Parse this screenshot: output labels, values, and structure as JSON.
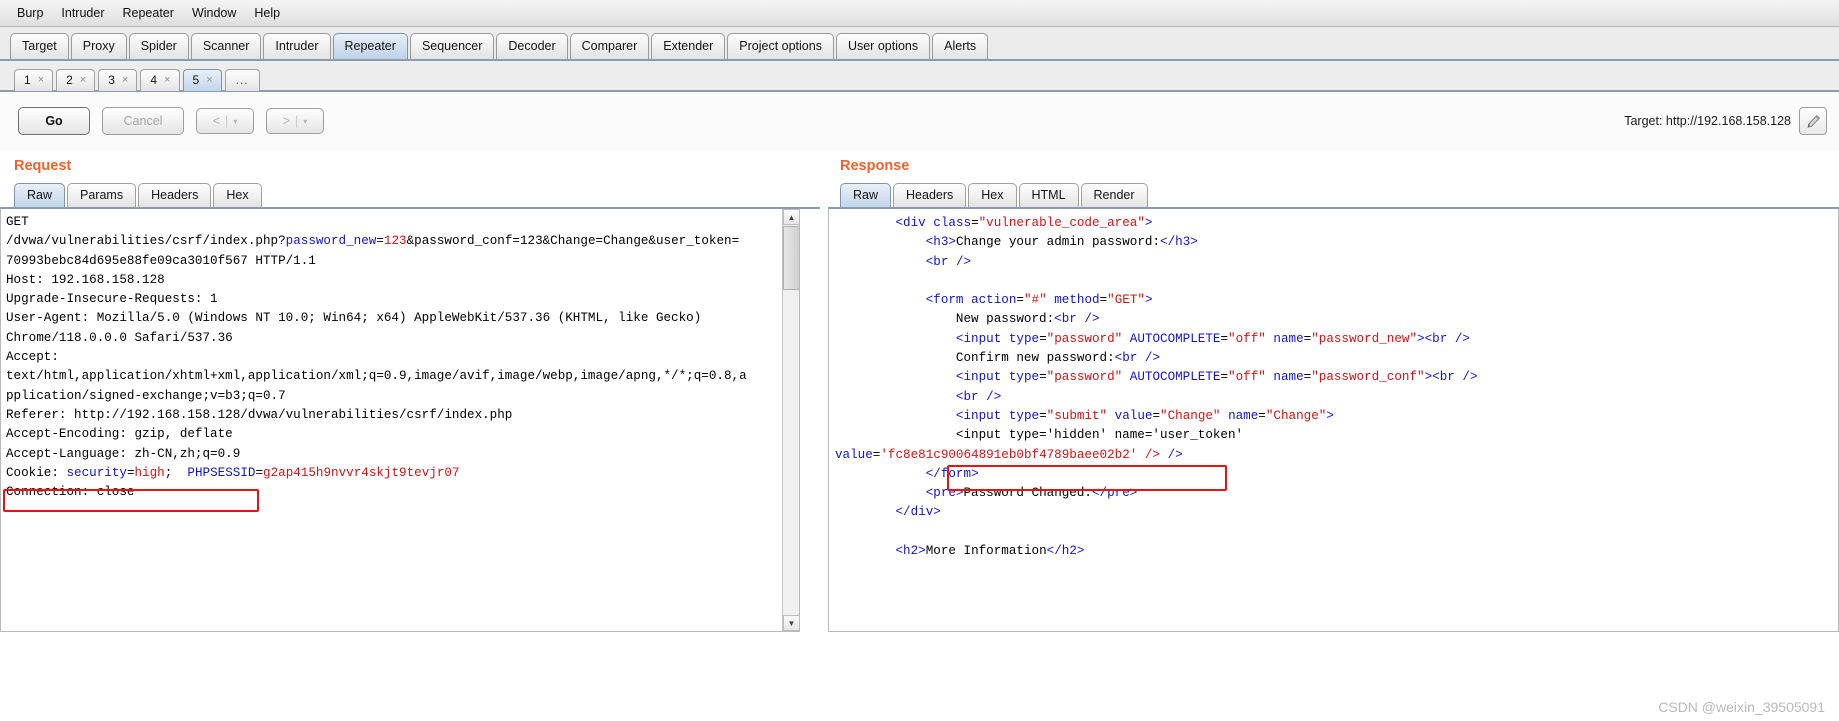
{
  "menubar": {
    "items": [
      "Burp",
      "Intruder",
      "Repeater",
      "Window",
      "Help"
    ]
  },
  "main_tabs": {
    "items": [
      "Target",
      "Proxy",
      "Spider",
      "Scanner",
      "Intruder",
      "Repeater",
      "Sequencer",
      "Decoder",
      "Comparer",
      "Extender",
      "Project options",
      "User options",
      "Alerts"
    ],
    "active": "Repeater"
  },
  "repeater_tabs": {
    "items": [
      "1",
      "2",
      "3",
      "4",
      "5"
    ],
    "close_glyph": "×",
    "overflow_label": "...",
    "active": "5"
  },
  "toolbar": {
    "go_label": "Go",
    "cancel_label": "Cancel",
    "back_label": "<",
    "forward_label": ">",
    "dropdown_glyph": "▾",
    "separator_glyph": "|",
    "target_label": "Target: http://192.168.158.128",
    "edit_icon": "pencil-icon"
  },
  "request": {
    "title": "Request",
    "tabs": [
      "Raw",
      "Params",
      "Headers",
      "Hex"
    ],
    "active_tab": "Raw",
    "highlighted_token": "70993bebc84d695e88fe09ca3010f567",
    "lines": [
      "GET",
      "/dvwa/vulnerabilities/csrf/index.php?password_new=123&password_conf=123&Change=Change&user_token=",
      "70993bebc84d695e88fe09ca3010f567 HTTP/1.1",
      "Host: 192.168.158.128",
      "Upgrade-Insecure-Requests: 1",
      "User-Agent: Mozilla/5.0 (Windows NT 10.0; Win64; x64) AppleWebKit/537.36 (KHTML, like Gecko)",
      "Chrome/118.0.0.0 Safari/537.36",
      "Accept:",
      "text/html,application/xhtml+xml,application/xml;q=0.9,image/avif,image/webp,image/apng,*/*;q=0.8,a",
      "pplication/signed-exchange;v=b3;q=0.7",
      "Referer: http://192.168.158.128/dvwa/vulnerabilities/csrf/index.php",
      "Accept-Encoding: gzip, deflate",
      "Accept-Language: zh-CN,zh;q=0.9",
      "Cookie: security=high; PHPSESSID=g2ap415h9nvvr4skjt9tevjr07",
      "Connection: close"
    ]
  },
  "response": {
    "title": "Response",
    "tabs": [
      "Raw",
      "Headers",
      "Hex",
      "HTML",
      "Render"
    ],
    "active_tab": "Raw",
    "highlighted_text": "<pre>Password Changed.</pre>",
    "user_token_value": "fc8e81c90064891eb0bf4789baee02b2",
    "lines": [
      "        <div class=\"vulnerable_code_area\">",
      "            <h3>Change your admin password:</h3>",
      "            <br />",
      "",
      "            <form action=\"#\" method=\"GET\">",
      "                New password:<br />",
      "                <input type=\"password\" AUTOCOMPLETE=\"off\" name=\"password_new\"><br />",
      "                Confirm new password:<br />",
      "                <input type=\"password\" AUTOCOMPLETE=\"off\" name=\"password_conf\"><br />",
      "                <br />",
      "                <input type=\"submit\" value=\"Change\" name=\"Change\">",
      "                <input type='hidden' name='user_token'",
      "value='fc8e81c90064891eb0bf4789baee02b2' />",
      "            </form>",
      "            <pre>Password Changed.</pre>",
      "        </div>",
      "",
      "        <h2>More Information</h2>"
    ]
  },
  "watermark": "CSDN @weixin_39505091",
  "colors": {
    "accent": "#f2622b",
    "annotation": "#ee1111",
    "syntax_blue": "#1212d6",
    "syntax_red": "#d81111",
    "tab_active": "#c2d5ea"
  }
}
